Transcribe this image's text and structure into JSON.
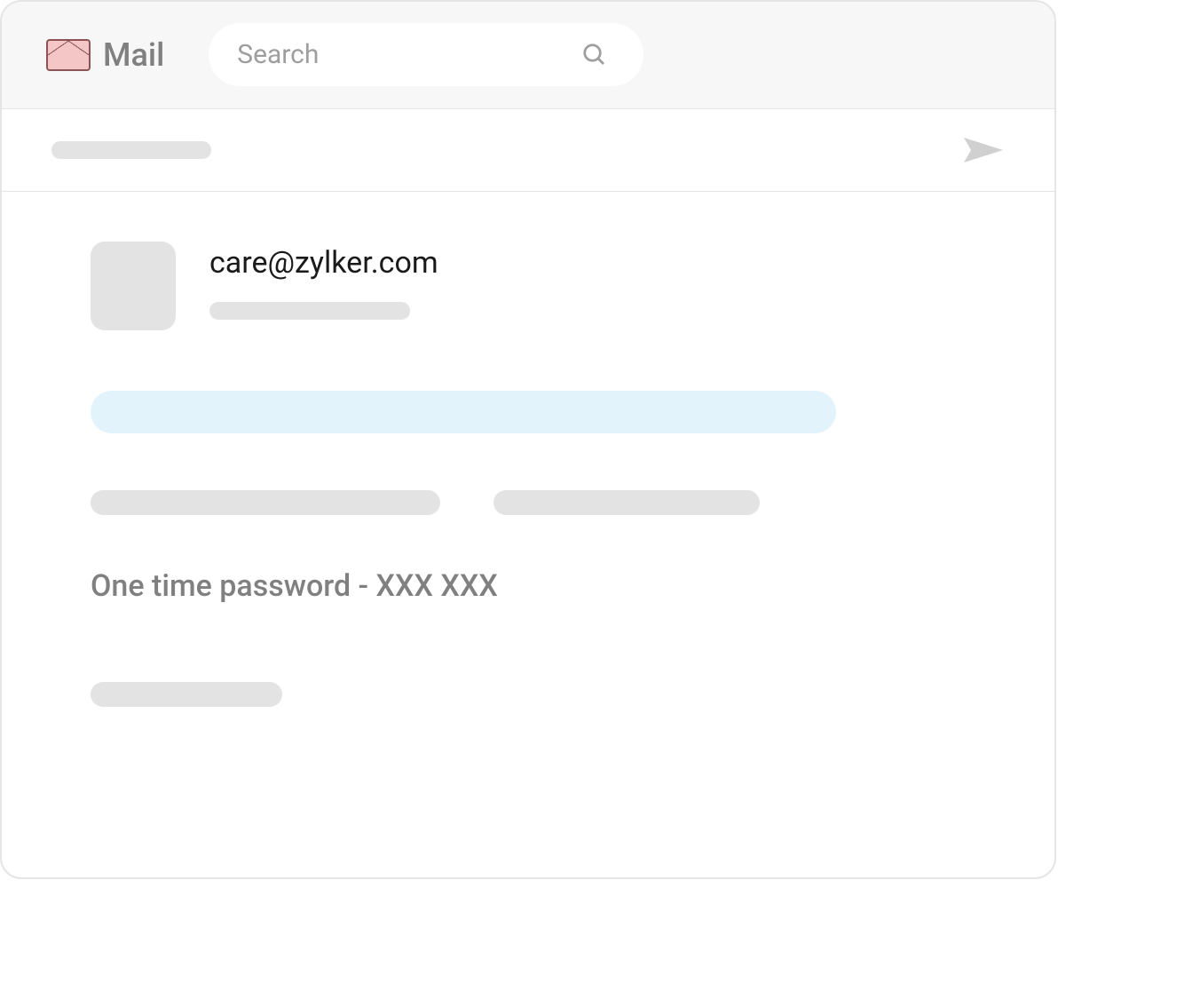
{
  "header": {
    "app_title": "Mail",
    "search_placeholder": "Search"
  },
  "message": {
    "sender_email": "care@zylker.com",
    "otp_line": "One time password - XXX XXX"
  },
  "colors": {
    "envelope_fill": "#f5c6c6",
    "envelope_border": "#8b5555",
    "highlight": "#e3f3fb",
    "placeholder": "#e3e3e3",
    "text_muted": "#808080"
  }
}
